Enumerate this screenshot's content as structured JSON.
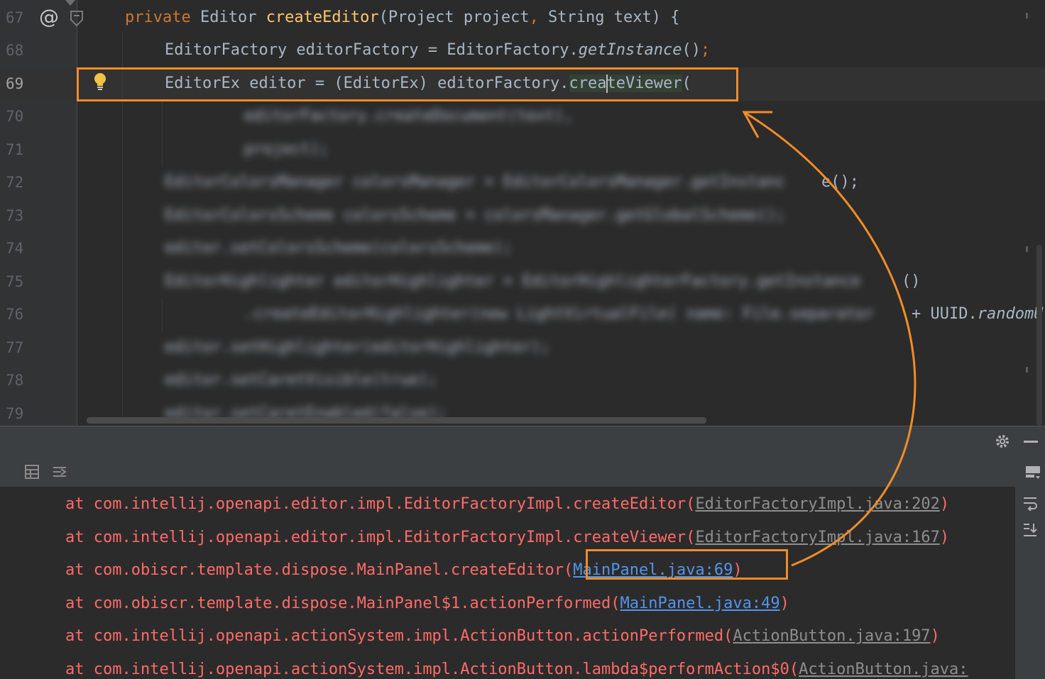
{
  "editor": {
    "line_numbers": [
      "67",
      "68",
      "69",
      "70",
      "71",
      "72",
      "73",
      "74",
      "75",
      "76",
      "77",
      "78",
      "79"
    ],
    "current_line": "69",
    "gutter_at_symbol": "@",
    "line67": {
      "keyword": "private",
      "type": " Editor ",
      "method": "createEditor",
      "params": "(Project project",
      "comma": ",",
      "params2": " String text) {"
    },
    "line68": {
      "decl": "EditorFactory editorFactory = EditorFactory.",
      "call": "getInstance",
      "parens": "()",
      "semi": ";"
    },
    "line69": {
      "decl": "EditorEx editor = (EditorEx) editorFactory.",
      "call_a": "crea",
      "call_b": "teViewer",
      "paren": "("
    },
    "line72_visible": "e();",
    "line75_visible": "()",
    "line76_visible": "+ UUID.",
    "line76_method": "randomU",
    "blurred": [
      "editorFactory.createDocument(text),",
      "project);",
      "EditorColorsManager colorsManager = EditorColorsManager.getInstanc",
      "EditorColorsScheme colorsScheme = colorsManager.getGlobalScheme();",
      "editor.setColorsScheme(colorsScheme);",
      "EditorHighlighter editorHighlighter = EditorHighlighterFactory.getInstance",
      ".createEditorHighlighter(new LightVirtualFile( name: File.separator",
      "editor.setHighlighter(editorHighlighter);",
      "editor.setCaretVisible(true);",
      "editor.setCaretEnabled(false);"
    ]
  },
  "console": {
    "lines": [
      {
        "text": "at com.intellij.openapi.editor.impl.EditorFactoryImpl.createEditor(",
        "loc": "EditorFactoryImpl.java:202",
        "close": ")",
        "is_link": false
      },
      {
        "text": "at com.intellij.openapi.editor.impl.EditorFactoryImpl.createViewer(",
        "loc": "EditorFactoryImpl.java:167",
        "close": ")",
        "is_link": false
      },
      {
        "text": "at com.obiscr.template.dispose.MainPanel.createEditor(",
        "loc": "MainPanel.java:69",
        "close": ")",
        "is_link": true
      },
      {
        "text": "at com.obiscr.template.dispose.MainPanel$1.actionPerformed(",
        "loc": "MainPanel.java:49",
        "close": ")",
        "is_link": true
      },
      {
        "text": "at com.intellij.openapi.actionSystem.impl.ActionButton.actionPerformed(",
        "loc": "ActionButton.java:197",
        "close": ")",
        "is_link": false
      },
      {
        "text": "at com.intellij.openapi.actionSystem.impl.ActionButton.lambda$performAction$0(",
        "loc": "ActionButton.java:",
        "close": "",
        "is_link": false
      }
    ]
  },
  "colors": {
    "annotation": "#f28c28",
    "error_text": "#ff6b68",
    "link": "#5394ec",
    "keyword": "#cc7832",
    "method": "#ffc66d"
  },
  "icons": [
    "at-sign-icon",
    "override-icon",
    "run-gutter-icon",
    "lightbulb-icon",
    "gear-icon",
    "minimize-icon",
    "table-icon",
    "diff-icon",
    "layout-icon",
    "soft-wrap-icon",
    "scroll-to-end-icon"
  ]
}
